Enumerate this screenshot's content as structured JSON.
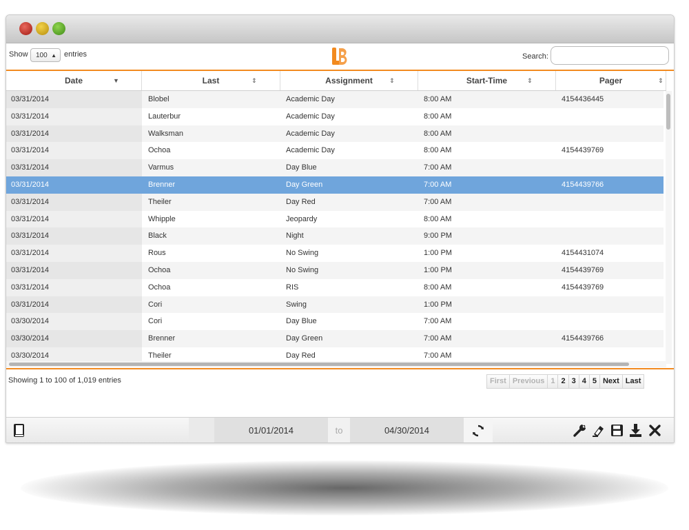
{
  "toolbar": {
    "show_label": "Show",
    "entries_value": "100",
    "entries_label": "entries",
    "search_label": "Search:",
    "search_value": "",
    "logo_color": "#f28a1f"
  },
  "table": {
    "columns": [
      {
        "label": "Date",
        "sort": "desc"
      },
      {
        "label": "Last",
        "sort": "both"
      },
      {
        "label": "Assignment",
        "sort": "both"
      },
      {
        "label": "Start-Time",
        "sort": "both"
      },
      {
        "label": "Pager",
        "sort": "both"
      }
    ],
    "rows": [
      [
        "03/31/2014",
        "Blobel",
        "Academic Day",
        "8:00 AM",
        "4154436445"
      ],
      [
        "03/31/2014",
        "Lauterbur",
        "Academic Day",
        "8:00 AM",
        ""
      ],
      [
        "03/31/2014",
        "Walksman",
        "Academic Day",
        "8:00 AM",
        ""
      ],
      [
        "03/31/2014",
        "Ochoa",
        "Academic Day",
        "8:00 AM",
        "4154439769"
      ],
      [
        "03/31/2014",
        "Varmus",
        "Day Blue",
        "7:00 AM",
        ""
      ],
      [
        "03/31/2014",
        "Brenner",
        "Day Green",
        "7:00 AM",
        "4154439766"
      ],
      [
        "03/31/2014",
        "Theiler",
        "Day Red",
        "7:00 AM",
        ""
      ],
      [
        "03/31/2014",
        "Whipple",
        "Jeopardy",
        "8:00 AM",
        ""
      ],
      [
        "03/31/2014",
        "Black",
        "Night",
        "9:00 PM",
        ""
      ],
      [
        "03/31/2014",
        "Rous",
        "No Swing",
        "1:00 PM",
        "4154431074"
      ],
      [
        "03/31/2014",
        "Ochoa",
        "No Swing",
        "1:00 PM",
        "4154439769"
      ],
      [
        "03/31/2014",
        "Ochoa",
        "RIS",
        "8:00 AM",
        "4154439769"
      ],
      [
        "03/31/2014",
        "Cori",
        "Swing",
        "1:00 PM",
        ""
      ],
      [
        "03/30/2014",
        "Cori",
        "Day Blue",
        "7:00 AM",
        ""
      ],
      [
        "03/30/2014",
        "Brenner",
        "Day Green",
        "7:00 AM",
        "4154439766"
      ],
      [
        "03/30/2014",
        "Theiler",
        "Day Red",
        "7:00 AM",
        ""
      ]
    ],
    "selected_row": 5,
    "selected_color": "#6fa5dc"
  },
  "info": {
    "text": "Showing 1 to 100 of 1,019 entries"
  },
  "pagination": [
    {
      "label": "First",
      "disabled": true
    },
    {
      "label": "Previous",
      "disabled": true
    },
    {
      "label": "1",
      "disabled": true
    },
    {
      "label": "2",
      "disabled": false
    },
    {
      "label": "3",
      "disabled": false
    },
    {
      "label": "4",
      "disabled": false
    },
    {
      "label": "5",
      "disabled": false
    },
    {
      "label": "Next",
      "disabled": false
    },
    {
      "label": "Last",
      "disabled": false
    }
  ],
  "footer": {
    "start_date": "01/01/2014",
    "to_label": "to",
    "end_date": "04/30/2014",
    "icons": [
      "wrench-icon",
      "eraser-icon",
      "save-icon",
      "download-icon",
      "close-icon"
    ]
  }
}
